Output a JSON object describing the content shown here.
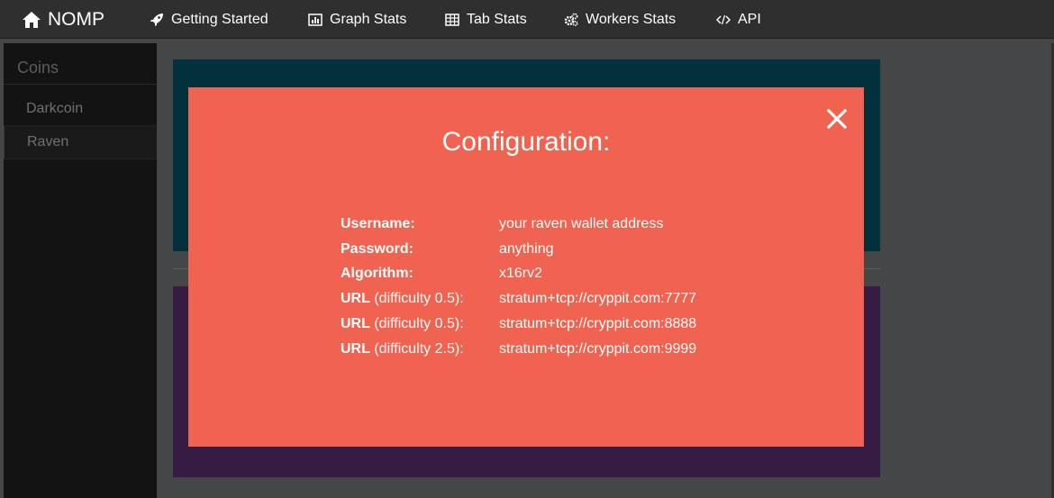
{
  "navbar": {
    "brand": {
      "label": "NOMP",
      "icon": "home-icon"
    },
    "items": [
      {
        "label": "Getting Started",
        "icon": "rocket-icon"
      },
      {
        "label": "Graph Stats",
        "icon": "bar-chart-icon"
      },
      {
        "label": "Tab Stats",
        "icon": "table-icon"
      },
      {
        "label": "Workers Stats",
        "icon": "gears-icon"
      },
      {
        "label": "API",
        "icon": "code-icon"
      }
    ]
  },
  "sidebar": {
    "title": "Coins",
    "coins": [
      {
        "label": "Darkcoin"
      },
      {
        "label": "Raven",
        "active": true
      }
    ]
  },
  "modal": {
    "title": "Configuration:",
    "close_icon": "close-icon",
    "rows": [
      {
        "label_bold": "Username:",
        "label_rest": "",
        "value": "your raven wallet address"
      },
      {
        "label_bold": "Password:",
        "label_rest": "",
        "value": "anything"
      },
      {
        "label_bold": "Algorithm:",
        "label_rest": "",
        "value": "x16rv2"
      },
      {
        "label_bold": "URL",
        "label_rest": " (difficulty 0.5):",
        "value": "stratum+tcp://cryppit.com:7777"
      },
      {
        "label_bold": "URL",
        "label_rest": " (difficulty 0.5):",
        "value": "stratum+tcp://cryppit.com:8888"
      },
      {
        "label_bold": "URL",
        "label_rest": " (difficulty 2.5):",
        "value": "stratum+tcp://cryppit.com:9999"
      }
    ]
  },
  "colors": {
    "navbar_bg": "#2f2f2f",
    "sidebar_bg": "#131313",
    "modal_bg": "#ef6350",
    "panel_teal": "#02313d",
    "panel_purple": "#361c42"
  }
}
